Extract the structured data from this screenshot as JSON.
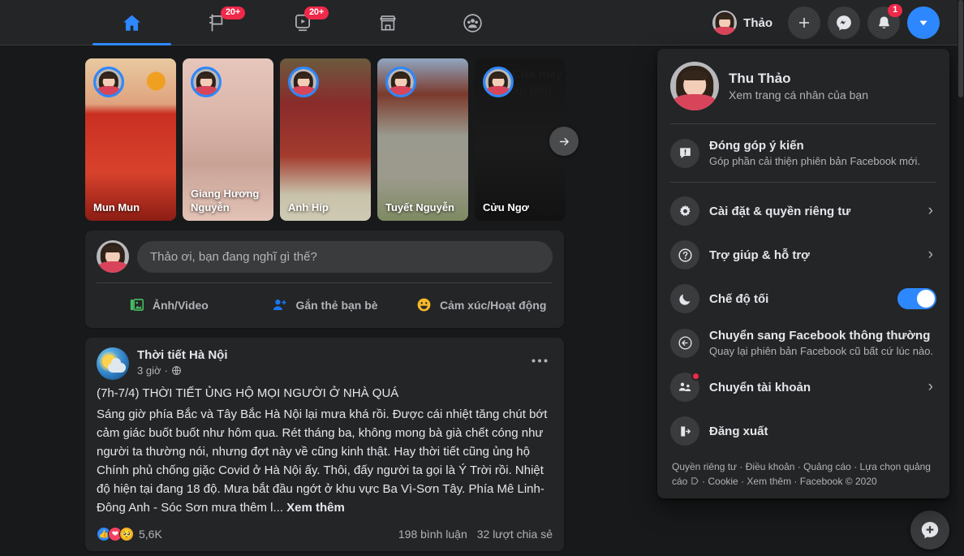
{
  "colors": {
    "page_bg": "#18191a",
    "surface": "#242526",
    "accent_blue": "#2d88ff",
    "badge_red": "#f02849",
    "text_primary": "#e4e6eb",
    "text_secondary": "#b0b3b8"
  },
  "nav": {
    "items": [
      {
        "name": "home",
        "icon": "home-icon",
        "active": true,
        "badge": ""
      },
      {
        "name": "stories",
        "icon": "flag-story-icon",
        "active": false,
        "badge": "20+"
      },
      {
        "name": "watch",
        "icon": "watch-play-icon",
        "active": false,
        "badge": "20+"
      },
      {
        "name": "marketplace",
        "icon": "marketplace-shop-icon",
        "active": false,
        "badge": ""
      },
      {
        "name": "groups",
        "icon": "groups-icon",
        "active": false,
        "badge": ""
      }
    ]
  },
  "header": {
    "profile_name": "Thảo",
    "create_label": "+",
    "messenger_icon": "messenger-icon",
    "notifications_icon": "bell-icon",
    "notifications_badge": "1",
    "account_menu_icon": "chevron-down-icon"
  },
  "stories": {
    "next_arrow": "→",
    "items": [
      {
        "name": "Mun Mun",
        "overlay": "",
        "bg": "st-bg1"
      },
      {
        "name": "Giang Hương Nguyễn",
        "overlay": "",
        "bg": "st-bg2"
      },
      {
        "name": "Anh Híp",
        "overlay": "",
        "bg": "st-bg3"
      },
      {
        "name": "Tuyết Nguyễn",
        "overlay": "",
        "bg": "st-bg4"
      },
      {
        "name": "Cửu Ngơ",
        "overlay": "Chả mấy\nan tâm",
        "bg": "st-bg5"
      }
    ]
  },
  "composer": {
    "placeholder": "Thảo ơi, bạn đang nghĩ gì thế?",
    "actions": [
      {
        "label": "Ảnh/Video",
        "icon": "photo-video-icon",
        "color": "#45bd62"
      },
      {
        "label": "Gắn thẻ bạn bè",
        "icon": "tag-friends-icon",
        "color": "#1877f2"
      },
      {
        "label": "Cảm xúc/Hoạt động",
        "icon": "feeling-activity-icon",
        "color": "#f7b928"
      }
    ]
  },
  "post": {
    "page_name": "Thời tiết Hà Nội",
    "time": "3 giờ",
    "privacy_icon": "globe-icon",
    "more_icon": "more-options-icon",
    "headline": "(7h-7/4) THỜI TIẾT ỦNG HỘ MỌI NGƯỜI Ở NHÀ QUÁ",
    "body": "Sáng giờ phía Bắc và Tây Bắc Hà Nội lại mưa khá rồi. Được cái nhiệt tăng chút bớt cảm giác buốt buốt như hôm qua. Rét tháng ba, không mong bà già chết cóng như người ta thường nói, nhưng đợt này về cũng kinh thật. Hay thời tiết cũng ủng hộ Chính phủ chống giặc Covid ở Hà Nội ấy. Thôi, đấy người ta gọi là Ý Trời rồi. Nhiệt độ hiện tại đang 18 độ. Mưa bắt đầu ngớt ở khu vực Ba Vì-Sơn Tây. Phía Mê Linh-Đông Anh - Sóc Sơn mưa thêm l...",
    "see_more": "Xem thêm",
    "reaction_count": "5,6K",
    "reactions": [
      "like",
      "love",
      "care"
    ],
    "comments": "198 bình luận",
    "shares": "32 lượt chia sẻ"
  },
  "account_menu": {
    "profile": {
      "name": "Thu Thảo",
      "subtitle": "Xem trang cá nhân của bạn"
    },
    "items": [
      {
        "label": "Đóng góp ý kiến",
        "sub": "Góp phần cải thiện phiên bản Facebook mới.",
        "icon": "feedback-icon",
        "right": "none",
        "dot": false
      },
      {
        "label": "Cài đặt & quyền riêng tư",
        "sub": "",
        "icon": "gear-icon",
        "right": "chevron",
        "dot": false
      },
      {
        "label": "Trợ giúp & hỗ trợ",
        "sub": "",
        "icon": "help-icon",
        "right": "chevron",
        "dot": false
      },
      {
        "label": "Chế độ tối",
        "sub": "",
        "icon": "moon-icon",
        "right": "toggle",
        "dot": false
      },
      {
        "label": "Chuyển sang Facebook thông thường",
        "sub": "Quay lại phiên bản Facebook cũ bất cứ lúc nào.",
        "icon": "back-arrow-icon",
        "right": "none",
        "dot": false
      },
      {
        "label": "Chuyển tài khoản",
        "sub": "",
        "icon": "switch-account-icon",
        "right": "chevron",
        "dot": true
      },
      {
        "label": "Đăng xuất",
        "sub": "",
        "icon": "logout-icon",
        "right": "none",
        "dot": false
      }
    ],
    "footer_links": [
      "Quyền riêng tư",
      "Điều khoản",
      "Quảng cáo",
      "Lựa chọn quảng cáo",
      "Cookie",
      "Xem thêm",
      "Facebook © 2020"
    ],
    "chevron_glyph": "›"
  },
  "fab": {
    "icon": "new-message-icon"
  }
}
